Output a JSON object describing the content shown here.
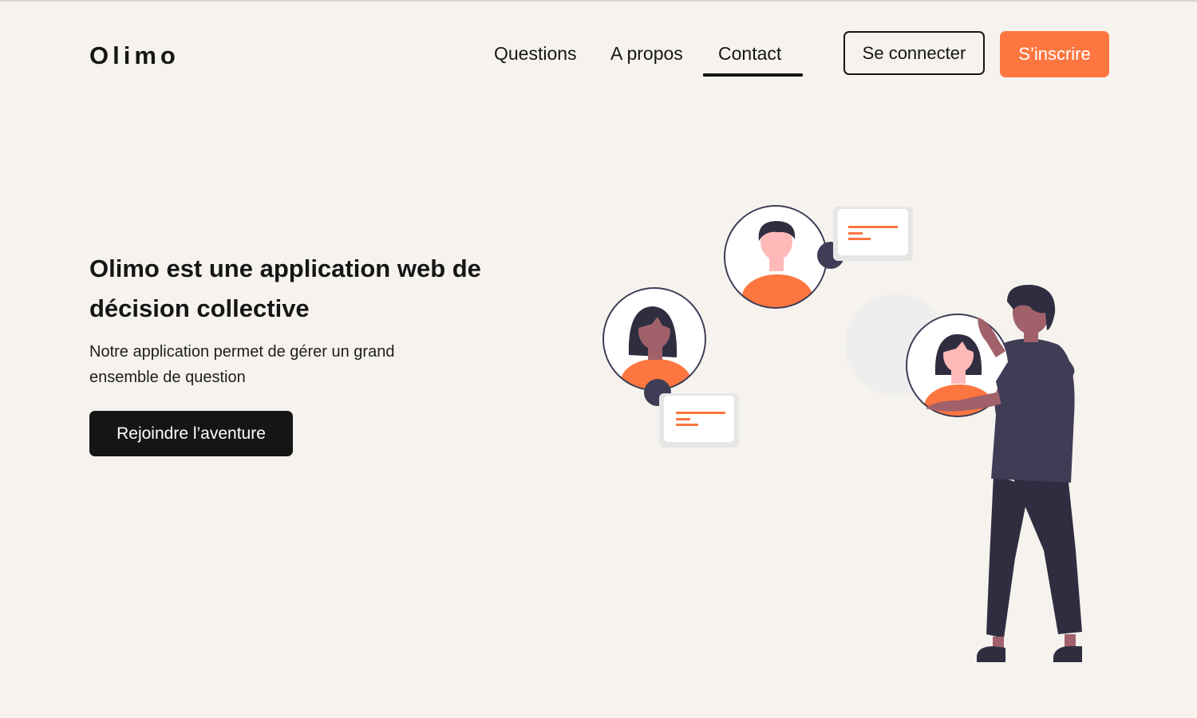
{
  "header": {
    "logo": "Olimo",
    "nav": [
      {
        "label": "Questions"
      },
      {
        "label": "A propos"
      },
      {
        "label": "Contact"
      }
    ],
    "login_label": "Se connecter",
    "signup_label": "S’inscrire"
  },
  "hero": {
    "title": "Olimo est une application web de décision collective",
    "subtitle": "Notre application permet de gérer un grand ensemble de question",
    "cta_label": "Rejoindre l’aventure"
  },
  "colors": {
    "background": "#f6f3ef",
    "accent": "#fd7640",
    "dark": "#151516",
    "figure": "#3f3d56"
  },
  "illustration": {
    "icon": "people-collaboration-illustration"
  }
}
